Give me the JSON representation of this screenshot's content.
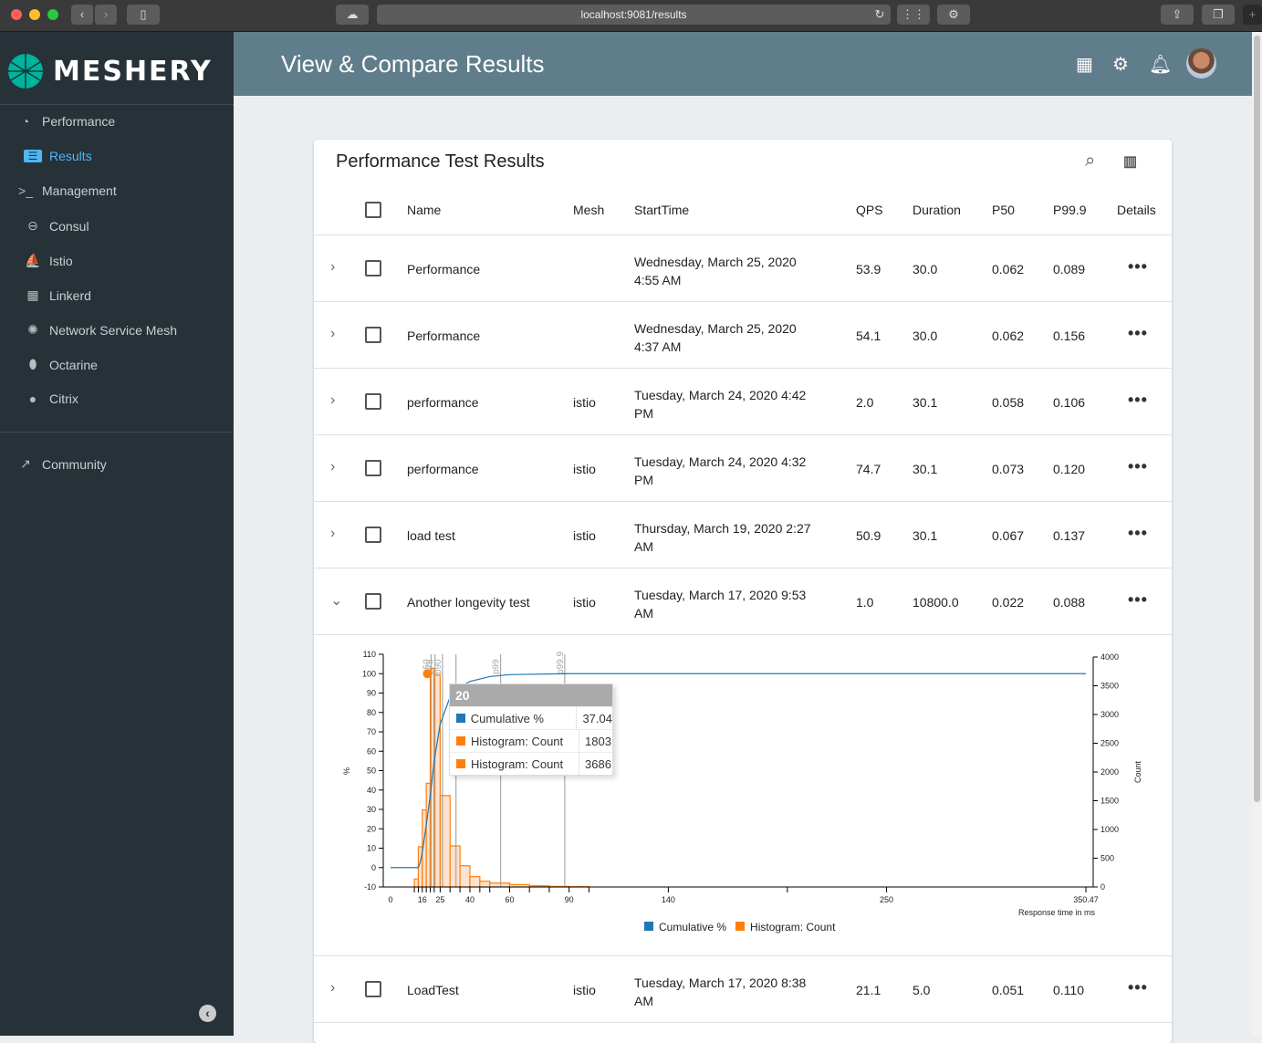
{
  "browser": {
    "url": "localhost:9081/results"
  },
  "sidebar": {
    "brand": "MESHERY",
    "items": [
      {
        "label": "Performance",
        "icon": "speedometer-icon"
      },
      {
        "label": "Results",
        "icon": "results-icon"
      },
      {
        "label": "Management",
        "icon": "terminal-icon"
      },
      {
        "label": "Consul",
        "icon": "consul-icon"
      },
      {
        "label": "Istio",
        "icon": "istio-icon"
      },
      {
        "label": "Linkerd",
        "icon": "linkerd-icon"
      },
      {
        "label": "Network Service Mesh",
        "icon": "nsm-icon"
      },
      {
        "label": "Octarine",
        "icon": "octarine-icon"
      },
      {
        "label": "Citrix",
        "icon": "citrix-icon"
      },
      {
        "label": "Community",
        "icon": "external-link-icon"
      }
    ]
  },
  "header": {
    "title": "View & Compare Results"
  },
  "card": {
    "title": "Performance Test Results",
    "columns": [
      "Name",
      "Mesh",
      "StartTime",
      "QPS",
      "Duration",
      "P50",
      "P99.9",
      "Details"
    ],
    "rows": [
      {
        "name": "Performance",
        "mesh": "",
        "start1": "Wednesday, March 25, 2020",
        "start2": "4:55 AM",
        "qps": "53.9",
        "duration": "30.0",
        "p50": "0.062",
        "p999": "0.089"
      },
      {
        "name": "Performance",
        "mesh": "",
        "start1": "Wednesday, March 25, 2020",
        "start2": "4:37 AM",
        "qps": "54.1",
        "duration": "30.0",
        "p50": "0.062",
        "p999": "0.156"
      },
      {
        "name": "performance",
        "mesh": "istio",
        "start1": "Tuesday, March 24, 2020 4:42",
        "start2": "PM",
        "qps": "2.0",
        "duration": "30.1",
        "p50": "0.058",
        "p999": "0.106"
      },
      {
        "name": "performance",
        "mesh": "istio",
        "start1": "Tuesday, March 24, 2020 4:32",
        "start2": "PM",
        "qps": "74.7",
        "duration": "30.1",
        "p50": "0.073",
        "p999": "0.120"
      },
      {
        "name": "load test",
        "mesh": "istio",
        "start1": "Thursday, March 19, 2020 2:27",
        "start2": "AM",
        "qps": "50.9",
        "duration": "30.1",
        "p50": "0.067",
        "p999": "0.137"
      },
      {
        "name": "Another longevity test",
        "mesh": "istio",
        "start1": "Tuesday, March 17, 2020 9:53",
        "start2": "AM",
        "qps": "1.0",
        "duration": "10800.0",
        "p50": "0.022",
        "p999": "0.088",
        "expanded": true
      },
      {
        "name": "LoadTest",
        "mesh": "istio",
        "start1": "Tuesday, March 17, 2020 8:38",
        "start2": "AM",
        "qps": "21.1",
        "duration": "5.0",
        "p50": "0.051",
        "p999": "0.110"
      }
    ]
  },
  "tooltip": {
    "title": "20",
    "rows": [
      {
        "label": "Cumulative %",
        "value": "37.04",
        "color": "#1f77b4"
      },
      {
        "label": "Histogram: Count",
        "value": "1803",
        "color": "#ff7f0e"
      },
      {
        "label": "Histogram: Count",
        "value": "3686",
        "color": "#ff7f0e"
      }
    ]
  },
  "chart_data": {
    "type": "bar+line",
    "xlabel": "Response time in ms",
    "ylabel": "%",
    "y2label": "Count",
    "xlim": [
      0,
      350.47
    ],
    "ylim": [
      -10,
      110
    ],
    "y2lim": [
      0,
      4000
    ],
    "xticks": [
      "0",
      "16",
      "25",
      "40",
      "60",
      "90",
      "140",
      "250",
      "350.47"
    ],
    "yticks": [
      "-10",
      "0",
      "10",
      "20",
      "30",
      "40",
      "50",
      "60",
      "70",
      "80",
      "90",
      "100",
      "110"
    ],
    "y2ticks": [
      "0",
      "500",
      "1000",
      "1500",
      "2000",
      "2500",
      "3000",
      "3500",
      "4000"
    ],
    "histogram": {
      "name": "Histogram: Count",
      "color": "#ff7f0e",
      "bins": [
        [
          12,
          14,
          138
        ],
        [
          14,
          16,
          700
        ],
        [
          16,
          18,
          1340
        ],
        [
          18,
          20,
          1803
        ],
        [
          20,
          22,
          3800
        ],
        [
          22,
          25,
          3686
        ],
        [
          25,
          30,
          1590
        ],
        [
          30,
          35,
          714
        ],
        [
          35,
          40,
          370
        ],
        [
          40,
          45,
          180
        ],
        [
          45,
          50,
          100
        ],
        [
          50,
          60,
          68
        ],
        [
          60,
          70,
          42
        ],
        [
          70,
          80,
          20
        ],
        [
          80,
          90,
          10
        ],
        [
          90,
          100,
          5
        ]
      ]
    },
    "cumulative": {
      "name": "Cumulative %",
      "color": "#1f77b4",
      "x": [
        0,
        14,
        15,
        16,
        18,
        20,
        22,
        25,
        30,
        35,
        40,
        50,
        60,
        90,
        350.47
      ],
      "y": [
        0,
        0,
        3,
        8,
        22,
        37,
        55,
        74,
        88,
        93,
        96,
        98.5,
        99.5,
        100,
        100
      ]
    },
    "percentiles": [
      {
        "label": "p50",
        "x": 20.4
      },
      {
        "label": "p75",
        "x": 22.4
      },
      {
        "label": "p90",
        "x": 26.2
      },
      {
        "label": "",
        "x": 33
      },
      {
        "label": "p99",
        "x": 55.5
      },
      {
        "label": "p99.9",
        "x": 87.8
      }
    ],
    "legend": [
      "Cumulative %",
      "Histogram: Count"
    ]
  }
}
